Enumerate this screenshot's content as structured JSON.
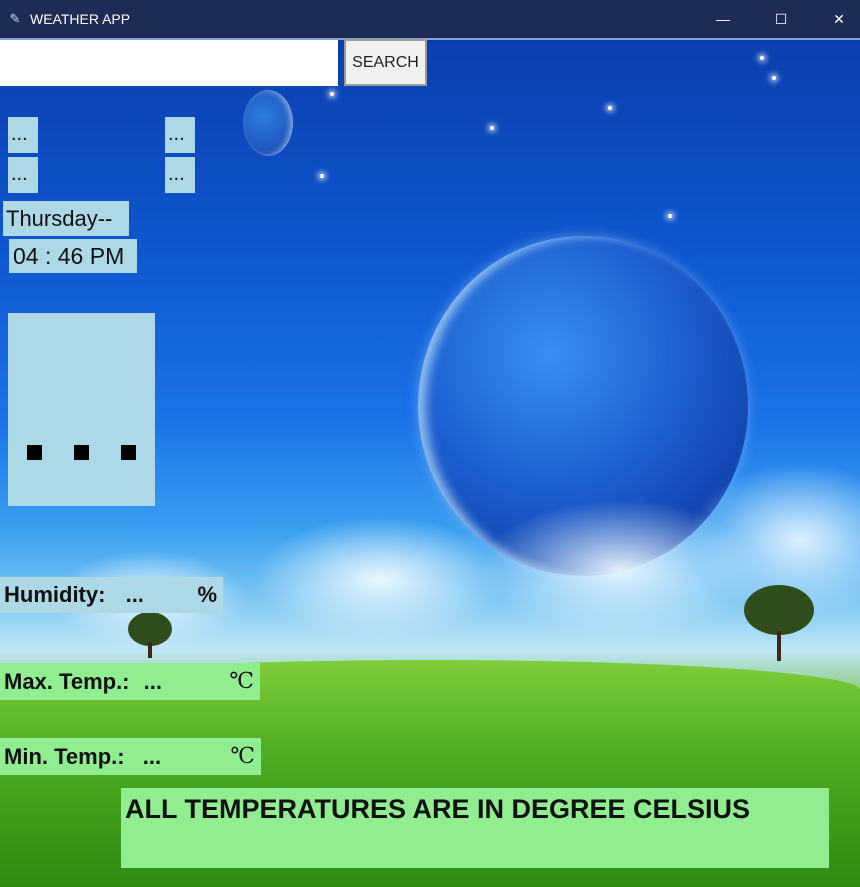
{
  "window": {
    "title": "WEATHER APP",
    "controls": {
      "minimize": "—",
      "maximize": "☐",
      "close": "✕"
    }
  },
  "search": {
    "value": "",
    "placeholder": "",
    "button_label": "SEARCH"
  },
  "info_labels": {
    "top_left": "...",
    "top_right": "...",
    "bottom_left": "...",
    "bottom_right": "..."
  },
  "day": "Thursday--",
  "time": "04 : 46 PM",
  "weather_icon_placeholder": "...",
  "humidity": {
    "label": "Humidity:",
    "value": "...",
    "unit": "%"
  },
  "max_temp": {
    "label": "Max. Temp.:",
    "value": "...",
    "unit": "℃"
  },
  "min_temp": {
    "label": "Min. Temp.:",
    "value": "...",
    "unit": "℃"
  },
  "footer_note": "ALL TEMPERATURES ARE IN DEGREE CELSIUS",
  "colors": {
    "titlebar": "#1f2b57",
    "light_blue": "#add8e6",
    "light_green": "#90ee90"
  }
}
